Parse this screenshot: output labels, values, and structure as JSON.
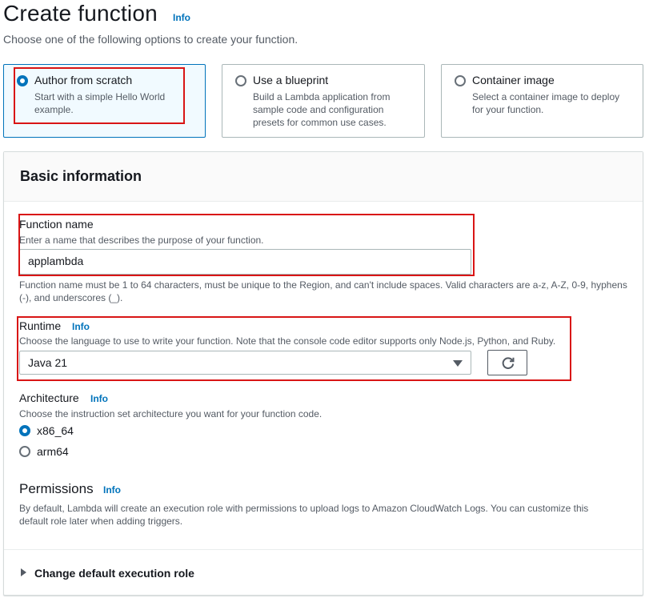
{
  "header": {
    "title": "Create function",
    "info": "Info",
    "subtitle": "Choose one of the following options to create your function."
  },
  "options": [
    {
      "title": "Author from scratch",
      "description": "Start with a simple Hello World example.",
      "selected": true
    },
    {
      "title": "Use a blueprint",
      "description": "Build a Lambda application from sample code and configuration presets for common use cases.",
      "selected": false
    },
    {
      "title": "Container image",
      "description": "Select a container image to deploy for your function.",
      "selected": false
    }
  ],
  "basic": {
    "title": "Basic information",
    "function_name": {
      "label": "Function name",
      "description": "Enter a name that describes the purpose of your function.",
      "value": "applambda",
      "constraint": "Function name must be 1 to 64 characters, must be unique to the Region, and can't include spaces. Valid characters are a-z, A-Z, 0-9, hyphens (-), and underscores (_)."
    },
    "runtime": {
      "label": "Runtime",
      "info": "Info",
      "description": "Choose the language to use to write your function. Note that the console code editor supports only Node.js, Python, and Ruby.",
      "value": "Java 21"
    },
    "architecture": {
      "label": "Architecture",
      "info": "Info",
      "description": "Choose the instruction set architecture you want for your function code.",
      "options": [
        "x86_64",
        "arm64"
      ],
      "selected": "x86_64"
    },
    "permissions": {
      "title": "Permissions",
      "info": "Info",
      "description": "By default, Lambda will create an execution role with permissions to upload logs to Amazon CloudWatch Logs. You can customize this default role later when adding triggers."
    },
    "expander_label": "Change default execution role"
  },
  "colors": {
    "accent": "#0073bb",
    "highlight": "#d91515",
    "text": "#16191f",
    "muted": "#545b64"
  },
  "icons": {
    "refresh": "refresh-icon",
    "dropdown": "caret-down-icon",
    "expander": "caret-right-icon"
  }
}
